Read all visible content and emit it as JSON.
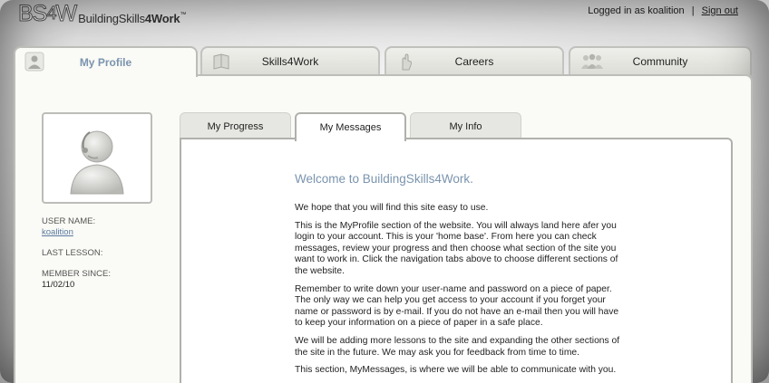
{
  "header": {
    "logo_mark": "BS",
    "logo_four": "4",
    "logo_mark_end": "W",
    "logo_name_a": "BuildingSkills",
    "logo_name_b": "4Work",
    "logo_tm": "™",
    "logged_in_text": "Logged in as koalition",
    "separator": "|",
    "sign_out": "Sign out"
  },
  "main_tabs": [
    {
      "label": "My Profile",
      "icon": "user-icon",
      "active": true
    },
    {
      "label": "Skills4Work",
      "icon": "book-icon",
      "active": false
    },
    {
      "label": "Careers",
      "icon": "hand-pointer-icon",
      "active": false
    },
    {
      "label": "Community",
      "icon": "people-icon",
      "active": false
    }
  ],
  "profile": {
    "user_name_label": "USER NAME:",
    "user_name": "koalition",
    "last_lesson_label": "LAST LESSON:",
    "member_since_label": "MEMBER SINCE:",
    "member_since": "11/02/10"
  },
  "sub_tabs": [
    {
      "label": "My Progress",
      "active": false
    },
    {
      "label": "My Messages",
      "active": true
    },
    {
      "label": "My Info",
      "active": false
    }
  ],
  "messages": {
    "title": "Welcome to BuildingSkills4Work.",
    "paragraphs": [
      "We hope that you will find this site easy to use.",
      "This is the MyProfile section of the website. You will always land here afer you login to your account. This is your 'home base'. From here you can check messages, review your progress and then choose what section of the site you want to work in. Click the navigation tabs above to choose different sections of the website.",
      "Remember to write down your user-name and password on a piece of paper. The only way we can help you get access to your account if you forget your name or password is by e-mail. If you do not have an e-mail then you will have to keep your information on a piece of paper in a safe place.",
      "We will be adding more lessons to the site and expanding the other sections of the site in the future. We may ask you for feedback from time to time.",
      "This section, MyMessages, is where we will be able to communicate with you."
    ]
  },
  "colors": {
    "accent": "#7a94ae",
    "panel_bg": "#fafaf6",
    "border": "#bcbcb8"
  }
}
